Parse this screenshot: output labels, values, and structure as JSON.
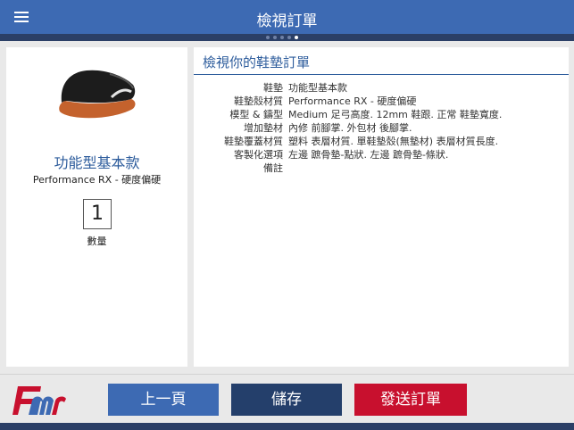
{
  "header": {
    "title": "檢視訂單",
    "page_count": 5,
    "active_page": 5
  },
  "product": {
    "name": "功能型基本款",
    "subtitle": "Performance RX - 硬度偏硬",
    "quantity": "1",
    "quantity_label": "數量"
  },
  "review": {
    "title": "檢視你的鞋墊訂單",
    "rows": [
      {
        "label": "鞋墊",
        "value": "功能型基本款"
      },
      {
        "label": "鞋墊殼材質",
        "value": "Performance RX - 硬度偏硬"
      },
      {
        "label": "模型 & 鑄型",
        "value": "Medium 足弓高度. 12mm 鞋跟.  正常 鞋墊寬度."
      },
      {
        "label": "增加墊材",
        "value": "內修 前腳掌. 外包材 後腳掌."
      },
      {
        "label": "鞋墊覆蓋材質",
        "value": "塑料 表層材質. 單鞋墊殼(無墊材) 表層材質長度."
      },
      {
        "label": "客製化選項",
        "value": "左邊 蹠骨墊-點狀. 左邊 蹠骨墊-條狀."
      },
      {
        "label": "備註",
        "value": ""
      }
    ]
  },
  "footer": {
    "prev_label": "上一頁",
    "save_label": "儲存",
    "send_label": "發送訂單"
  },
  "colors": {
    "primary": "#3d6ab3",
    "dark": "#243f6b",
    "accent_red": "#c8102e"
  }
}
